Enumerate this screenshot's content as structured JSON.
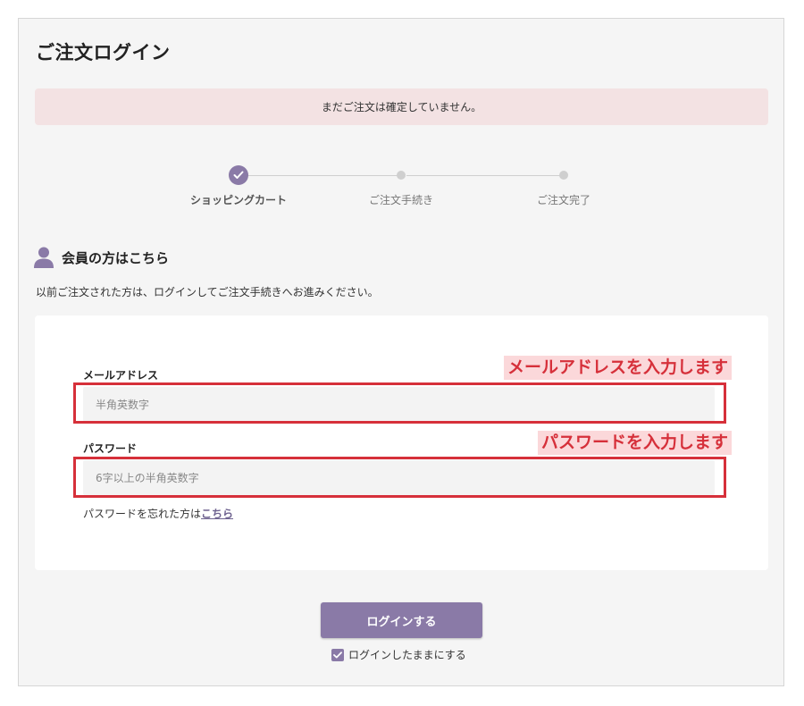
{
  "page": {
    "title": "ご注文ログイン",
    "alert": "まだご注文は確定していません。"
  },
  "steps": [
    {
      "label": "ショッピングカート",
      "state": "done"
    },
    {
      "label": "ご注文手続き",
      "state": "pending"
    },
    {
      "label": "ご注文完了",
      "state": "pending"
    }
  ],
  "member": {
    "heading": "会員の方はこちら",
    "intro": "以前ご注文された方は、ログインしてご注文手続きへお進みください。",
    "email": {
      "label": "メールアドレス",
      "placeholder": "半角英数字",
      "annotation": "メールアドレスを入力します"
    },
    "password": {
      "label": "パスワード",
      "placeholder": "6字以上の半角英数字",
      "annotation": "パスワードを入力します"
    },
    "forgot_text": "パスワードを忘れた方は",
    "forgot_link": "こちら"
  },
  "actions": {
    "login_label": "ログインする",
    "remember_label": "ログインしたままにする",
    "remember_checked": true
  },
  "colors": {
    "accent": "#8a7aa7",
    "alert_bg": "#f3e2e3",
    "annotation_red": "#d6303a",
    "annotation_bg": "#fbd8da"
  }
}
